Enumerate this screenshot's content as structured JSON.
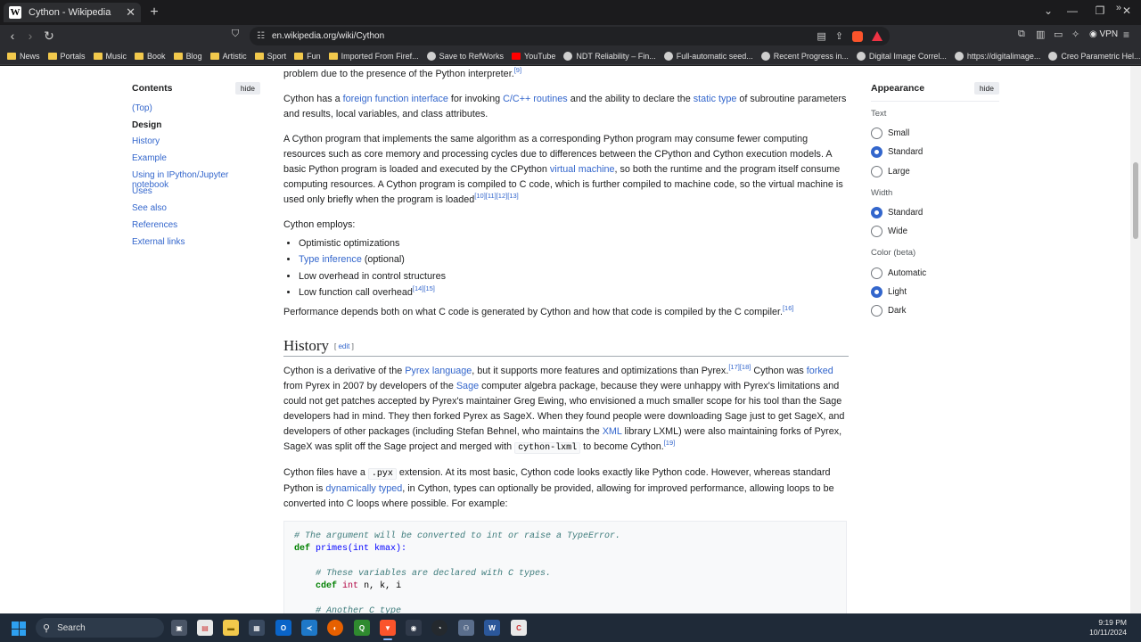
{
  "browser": {
    "tab_title": "Cython - Wikipedia",
    "tab_favicon": "W",
    "url": "en.wikipedia.org/wiki/Cython",
    "vpn_label": "VPN"
  },
  "bookmarks": [
    {
      "label": "News",
      "icon": "folder"
    },
    {
      "label": "Portals",
      "icon": "folder"
    },
    {
      "label": "Music",
      "icon": "folder"
    },
    {
      "label": "Book",
      "icon": "folder"
    },
    {
      "label": "Blog",
      "icon": "folder"
    },
    {
      "label": "Artistic",
      "icon": "folder"
    },
    {
      "label": "Sport",
      "icon": "folder"
    },
    {
      "label": "Fun",
      "icon": "folder"
    },
    {
      "label": "Imported From Firef...",
      "icon": "folder"
    },
    {
      "label": "Save to RefWorks",
      "icon": "round"
    },
    {
      "label": "YouTube",
      "icon": "youtube"
    },
    {
      "label": "NDT Reliability – Fin...",
      "icon": "round"
    },
    {
      "label": "Full-automatic seed...",
      "icon": "round"
    },
    {
      "label": "Recent Progress in...",
      "icon": "round"
    },
    {
      "label": "Digital Image Correl...",
      "icon": "round"
    },
    {
      "label": "https://digitalimage...",
      "icon": "round"
    },
    {
      "label": "Creo Parametric Hel...",
      "icon": "round"
    }
  ],
  "toc": {
    "title": "Contents",
    "hide": "hide",
    "items": [
      "(Top)",
      "Design",
      "History",
      "Example",
      "Using in IPython/Jupyter notebook",
      "Uses",
      "See also",
      "References",
      "External links"
    ]
  },
  "article": {
    "p0_text": "problem due to the presence of the Python interpreter.",
    "p0_sup": "[9]",
    "p1_a": "Cython has a ",
    "p1_link1": "foreign function interface",
    "p1_b": " for invoking ",
    "p1_link2": "C/C++ routines",
    "p1_c": " and the ability to declare the ",
    "p1_link3": "static type",
    "p1_d": " of subroutine parameters and results, local variables, and class attributes.",
    "p2_a": "A Cython program that implements the same algorithm as a corresponding Python program may consume fewer computing resources such as core memory and processing cycles due to differences between the CPython and Cython execution models. A basic Python program is loaded and executed by the CPython ",
    "p2_link": "virtual machine",
    "p2_b": ", so both the runtime and the program itself consume computing resources. A Cython program is compiled to C code, which is further compiled to machine code, so the virtual machine is used only briefly when the program is loaded",
    "p2_sup": "[10][11][12][13]",
    "p3": "Cython employs:",
    "list": [
      "Optimistic optimizations",
      "Type inference",
      "Low overhead in control structures",
      "Low function call overhead"
    ],
    "list_1_suffix": " (optional)",
    "list_3_sup": "[14][15]",
    "p4": "Performance depends both on what C code is generated by Cython and how that code is compiled by the C compiler.",
    "p4_sup": "[16]",
    "history_heading": "History",
    "edit_label": "edit",
    "h1_a": "Cython is a derivative of the ",
    "h1_link1": "Pyrex language",
    "h1_b": ", but it supports more features and optimizations than Pyrex.",
    "h1_sup1": "[17][18]",
    "h1_c": " Cython was ",
    "h1_link2": "forked",
    "h1_d": " from Pyrex in 2007 by developers of the ",
    "h1_link3": "Sage",
    "h1_e": " computer algebra package, because they were unhappy with Pyrex's limitations and could not get patches accepted by Pyrex's maintainer Greg Ewing, who envisioned a much smaller scope for his tool than the Sage developers had in mind. They then forked Pyrex as SageX. When they found people were downloading Sage just to get SageX, and developers of other packages (including Stefan Behnel, who maintains the ",
    "h1_link4": "XML",
    "h1_f": " library LXML) were also maintaining forks of Pyrex, SageX was split off the Sage project and merged with ",
    "h1_code": "cython-lxml",
    "h1_g": " to become Cython.",
    "h1_sup2": "[19]",
    "h2_a": "Cython files have a ",
    "h2_code": ".pyx",
    "h2_b": " extension. At its most basic, Cython code looks exactly like Python code. However, whereas standard Python is ",
    "h2_link": "dynamically typed",
    "h2_c": ", in Cython, types can optionally be provided, allowing for improved performance, allowing loops to be converted into C loops where possible. For example:",
    "code_lines": [
      "# The argument will be converted to int or raise a TypeError.",
      "def primes(int kmax):",
      "",
      "    # These variables are declared with C types.",
      "    cdef int n, k, i",
      "",
      "    # Another C type"
    ]
  },
  "appearance": {
    "title": "Appearance",
    "hide": "hide",
    "text_label": "Text",
    "text_options": [
      "Small",
      "Standard",
      "Large"
    ],
    "text_selected": "Standard",
    "width_label": "Width",
    "width_options": [
      "Standard",
      "Wide"
    ],
    "width_selected": "Standard",
    "color_label": "Color (beta)",
    "color_options": [
      "Automatic",
      "Light",
      "Dark"
    ],
    "color_selected": "Light"
  },
  "taskbar": {
    "search_placeholder": "Search",
    "time": "9:19 PM",
    "date": "10/11/2024"
  },
  "colors": {
    "link": "#3366cc",
    "radio_on": "#3366cc",
    "taskbar_bg": "#1f2a38"
  }
}
